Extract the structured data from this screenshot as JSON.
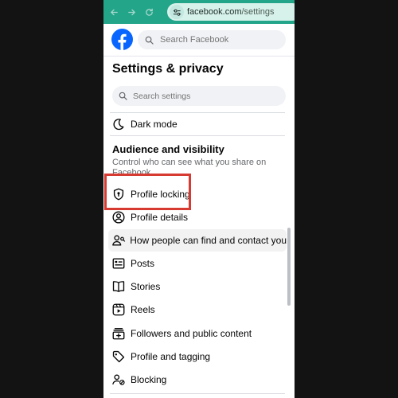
{
  "browser": {
    "url_domain": "facebook.com",
    "url_path": "/settings",
    "bar_color": "#23a58a"
  },
  "header": {
    "search_placeholder": "Search Facebook",
    "brand_color": "#0866ff"
  },
  "page": {
    "title": "Settings & privacy",
    "search_placeholder": "Search settings"
  },
  "items_top": [
    {
      "label": "Dark mode",
      "icon": "moon-icon"
    }
  ],
  "section": {
    "title": "Audience and visibility",
    "description": "Control who can see what you share on Facebook."
  },
  "items": [
    {
      "label": "Profile locking",
      "icon": "shield-lock-icon",
      "highlighted_box": true
    },
    {
      "label": "Profile details",
      "icon": "profile-icon"
    },
    {
      "label": "How people can find and contact you",
      "icon": "find-people-icon",
      "hovered": true
    },
    {
      "label": "Posts",
      "icon": "posts-icon"
    },
    {
      "label": "Stories",
      "icon": "stories-icon"
    },
    {
      "label": "Reels",
      "icon": "reels-icon"
    },
    {
      "label": "Followers and public content",
      "icon": "followers-icon"
    },
    {
      "label": "Profile and tagging",
      "icon": "tag-icon"
    },
    {
      "label": "Blocking",
      "icon": "blocking-icon"
    }
  ],
  "highlight_color": "#d73a31"
}
